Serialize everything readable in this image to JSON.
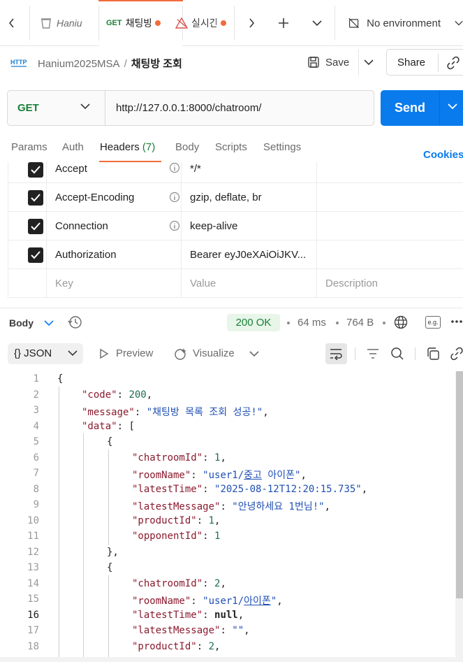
{
  "tabs": {
    "items": [
      {
        "method": "",
        "label": "Haniu"
      },
      {
        "method": "GET",
        "label": "채팅방"
      },
      {
        "method": "",
        "label": "실시간"
      }
    ],
    "environment": "No environment"
  },
  "breadcrumb": {
    "icon_text": "HTTP",
    "collection": "Hanium2025MSA",
    "separator": "/",
    "request": "채팅방 조회"
  },
  "toolbar": {
    "save_label": "Save",
    "share_label": "Share"
  },
  "request": {
    "method": "GET",
    "url": "http://127.0.0.1:8000/chatroom/",
    "send_label": "Send"
  },
  "request_tabs": {
    "params": "Params",
    "auth": "Auth",
    "headers": "Headers",
    "headers_count": "(7)",
    "body": "Body",
    "scripts": "Scripts",
    "settings": "Settings",
    "cookies": "Cookies"
  },
  "headers_table": {
    "rows": [
      {
        "key": "Accept",
        "value": "*/*",
        "checked": true
      },
      {
        "key": "Accept-Encoding",
        "value": "gzip, deflate, br",
        "checked": true
      },
      {
        "key": "Connection",
        "value": "keep-alive",
        "checked": true
      },
      {
        "key": "Authorization",
        "value": "Bearer eyJ0eXAiOiJKV...",
        "checked": true
      }
    ],
    "placeholders": {
      "key": "Key",
      "value": "Value",
      "description": "Description"
    }
  },
  "response": {
    "section_label": "Body",
    "status": "200 OK",
    "time": "64 ms",
    "size": "764 B",
    "format": "{} JSON",
    "preview": "Preview",
    "visualize": "Visualize",
    "eg_badge": "e.g."
  },
  "code": {
    "line_numbers": [
      "1",
      "2",
      "3",
      "4",
      "5",
      "6",
      "7",
      "8",
      "9",
      "10",
      "11",
      "12",
      "13",
      "14",
      "15",
      "16",
      "17",
      "18"
    ],
    "current_line": 16,
    "tokens": {
      "l1": "{",
      "l2_key": "\"code\"",
      "l2_val": "200",
      "l3_key": "\"message\"",
      "l3_val": "\"채팅방 목록 조회 성공!\"",
      "l4_key": "\"data\"",
      "l4_val": "[",
      "l5": "{",
      "l6_key": "\"chatroomId\"",
      "l6_val": "1",
      "l7_key": "\"roomName\"",
      "l7_val_a": "\"user1/",
      "l7_val_b": "중고",
      "l7_val_c": " 아이폰\"",
      "l8_key": "\"latestTime\"",
      "l8_val": "\"2025-08-12T12:20:15.735\"",
      "l9_key": "\"latestMessage\"",
      "l9_val": "\"안녕하세요 1번님!\"",
      "l10_key": "\"productId\"",
      "l10_val": "1",
      "l11_key": "\"opponentId\"",
      "l11_val": "1",
      "l12": "},",
      "l13": "{",
      "l14_key": "\"chatroomId\"",
      "l14_val": "2",
      "l15_key": "\"roomName\"",
      "l15_val_a": "\"user1/",
      "l15_val_b": "아이폰",
      "l15_val_c": "\"",
      "l16_key": "\"latestTime\"",
      "l16_val": "null",
      "l17_key": "\"latestMessage\"",
      "l17_val": "\"\"",
      "l18_key": "\"productId\"",
      "l18_val": "2"
    }
  },
  "colors": {
    "accent": "#f26b3a",
    "send": "#097bed",
    "get_method": "#1a7f37",
    "json_key": "#8b1a2e",
    "json_string": "#1f4fb4",
    "json_number": "#1f6d51"
  },
  "icons": [
    "chevron-left-icon",
    "document-icon",
    "warning-icon",
    "chevron-right-icon",
    "plus-icon",
    "chevron-down-icon",
    "no-environment-icon",
    "http-icon",
    "save-icon",
    "link-icon",
    "info-icon",
    "history-icon",
    "globe-icon",
    "more-icon",
    "play-icon",
    "visualize-icon",
    "wrap-icon",
    "filter-icon",
    "search-icon",
    "copy-icon"
  ]
}
